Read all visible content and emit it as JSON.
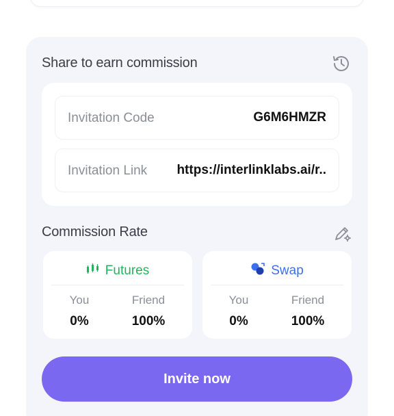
{
  "share": {
    "title": "Share to earn commission",
    "history_icon": "history-icon",
    "invitation_code_label": "Invitation Code",
    "invitation_code_value": "G6M6HMZR",
    "invitation_link_label": "Invitation Link",
    "invitation_link_value": "https://interlinklabs.ai/r.."
  },
  "commission": {
    "title": "Commission Rate",
    "edit_icon": "edit-settings-icon",
    "cards": [
      {
        "name": "Futures",
        "icon": "futures-chart-icon",
        "color": "#22b45a",
        "you_label": "You",
        "you_value": "0%",
        "friend_label": "Friend",
        "friend_value": "100%"
      },
      {
        "name": "Swap",
        "icon": "swap-icon",
        "color": "#3c6ff0",
        "you_label": "You",
        "you_value": "0%",
        "friend_label": "Friend",
        "friend_value": "100%"
      }
    ]
  },
  "invite_button": {
    "label": "Invite now",
    "color": "#7b68f0"
  }
}
